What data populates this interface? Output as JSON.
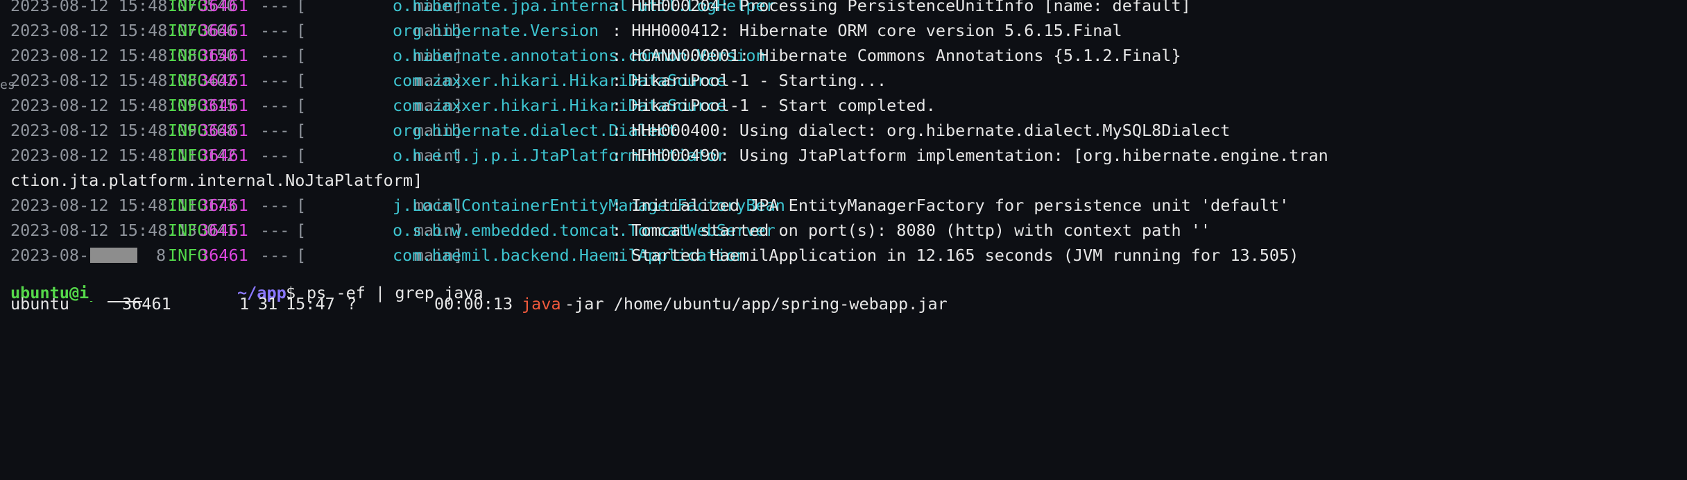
{
  "log_lines": [
    {
      "ts": "2023-08-12 15:48:07.540",
      "level": "INFO",
      "pid": "36461",
      "sep": "---",
      "thread": "[           main]",
      "logger": "o.hibernate.jpa.internal.util.LogHelper",
      "msg": ": HHH000204: Processing PersistenceUnitInfo [name: default]"
    },
    {
      "ts": "2023-08-12 15:48:07.666",
      "level": "INFO",
      "pid": "36461",
      "sep": "---",
      "thread": "[           main]",
      "logger": "org.hibernate.Version",
      "msg": ": HHH000412: Hibernate ORM core version 5.6.15.Final"
    },
    {
      "ts": "2023-08-12 15:48:08.150",
      "level": "INFO",
      "pid": "36461",
      "sep": "---",
      "thread": "[           main]",
      "logger": "o.hibernate.annotations.common.Version",
      "msg": ": HCANN000001: Hibernate Commons Annotations {5.1.2.Final}"
    },
    {
      "ts": "2023-08-12 15:48:08.402",
      "level": "INFO",
      "pid": "36461",
      "sep": "---",
      "thread": "[           main]",
      "logger": "com.zaxxer.hikari.HikariDataSource",
      "msg": ": HikariPool-1 - Starting..."
    },
    {
      "ts": "2023-08-12 15:48:09.315",
      "level": "INFO",
      "pid": "36461",
      "sep": "---",
      "thread": "[           main]",
      "logger": "com.zaxxer.hikari.HikariDataSource",
      "msg": ": HikariPool-1 - Start completed."
    },
    {
      "ts": "2023-08-12 15:48:09.368",
      "level": "INFO",
      "pid": "36461",
      "sep": "---",
      "thread": "[           main]",
      "logger": "org.hibernate.dialect.Dialect",
      "msg": ": HHH000400: Using dialect: org.hibernate.dialect.MySQL8Dialect"
    },
    {
      "ts": "2023-08-12 15:48:11.142",
      "level": "INFO",
      "pid": "36461",
      "sep": "---",
      "thread": "[           main]",
      "logger": "o.h.e.t.j.p.i.JtaPlatformInitiator",
      "msg": ": HHH000490: Using JtaPlatform implementation: [org.hibernate.engine.tran"
    },
    {
      "continuation": "ction.jta.platform.internal.NoJtaPlatform]"
    },
    {
      "ts": "2023-08-12 15:48:11.173",
      "level": "INFO",
      "pid": "36461",
      "sep": "---",
      "thread": "[           main]",
      "logger": "j.LocalContainerEntityManagerFactoryBean",
      "msg": ": Initialized JPA EntityManagerFactory for persistence unit 'default'"
    },
    {
      "ts": "2023-08-12 15:48:13.041",
      "level": "INFO",
      "pid": "36461",
      "sep": "---",
      "thread": "[           main]",
      "logger": "o.s.b.w.embedded.tomcat.TomcatWebServer",
      "msg": ": Tomcat started on port(s): 8080 (http) with context path ''"
    },
    {
      "ts": "2023-08-1",
      "ts_tail": "8",
      "level": "INFO",
      "pid": "36461",
      "sep": "---",
      "thread": "[           main]",
      "logger": "com.haemil.backend.HaemilApplication",
      "msg": ": Started HaemilApplication in 12.165 seconds (JVM running for 13.505)"
    }
  ],
  "prompt": {
    "user": "ubuntu@ip",
    "path": "~/app",
    "symbol": "$",
    "command": "ps -ef | grep java"
  },
  "ps_row": {
    "user": "ubuntu",
    "pid": "36461",
    "ppid": "1",
    "c": "31",
    "stime": "15:47",
    "tty": "?",
    "time": "00:00:13",
    "cmd": "java",
    "args": "-jar /home/ubuntu/app/spring-webapp.jar"
  },
  "edge_text": "es",
  "colors": {
    "background": "#0d0f14",
    "timestamp": "#8f949c",
    "level_info": "#52d84a",
    "pid": "#e045e0",
    "logger": "#3dc4d0",
    "prompt_user": "#55d84a",
    "prompt_path": "#8a78ff",
    "java_cmd": "#f05a3c"
  }
}
